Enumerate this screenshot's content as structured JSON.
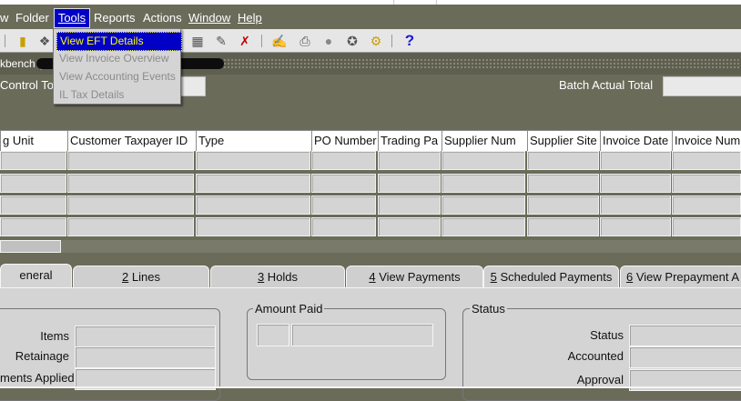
{
  "menu": {
    "items": [
      "w",
      "Folder",
      "Tools",
      "Reports",
      "Actions",
      "Window",
      "Help"
    ],
    "open": "Tools"
  },
  "tools_menu": {
    "items": [
      {
        "label": "View EFT Details",
        "enabled": true,
        "highlighted": true
      },
      {
        "label": "View Invoice Overview",
        "enabled": false
      },
      {
        "label": "View Accounting Events",
        "enabled": false
      },
      {
        "label": "IL Tax Details",
        "enabled": false
      }
    ]
  },
  "titlebar": {
    "text": "kbench ("
  },
  "header": {
    "control_total_label": "Control Tot",
    "batch_actual_total_label": "Batch Actual Total",
    "control_total_value": "",
    "batch_actual_total_value": ""
  },
  "grid": {
    "columns": [
      "g Unit",
      "Customer Taxpayer ID",
      "Type",
      "PO Number",
      "Trading Pa",
      "Supplier Num",
      "Supplier Site",
      "Invoice Date",
      "Invoice Num"
    ],
    "row_count": 4
  },
  "tabs": [
    {
      "key": "",
      "label": "eneral",
      "active": true
    },
    {
      "key": "2",
      "label": " Lines",
      "active": false
    },
    {
      "key": "3",
      "label": " Holds",
      "active": false
    },
    {
      "key": "4",
      "label": " View Payments",
      "active": false
    },
    {
      "key": "5",
      "label": " Scheduled Payments",
      "active": false
    },
    {
      "key": "6",
      "label": " View Prepayment A",
      "active": false
    }
  ],
  "panel": {
    "left_group": {
      "fields": [
        "Items",
        "Retainage",
        "ments Applied"
      ]
    },
    "amount_paid": {
      "title": "Amount Paid"
    },
    "status": {
      "title": "Status",
      "fields": [
        "Status",
        "Accounted",
        "Approval"
      ]
    }
  },
  "toolbar": {
    "icons": [
      "folder-open-icon",
      "navigator-icon",
      "paste-icon",
      "edit-icon",
      "delete-record-icon",
      "pen-icon",
      "print-icon",
      "globe-icon",
      "attachment-icon",
      "tools-icon",
      "help-icon"
    ],
    "help_glyph": "?"
  }
}
